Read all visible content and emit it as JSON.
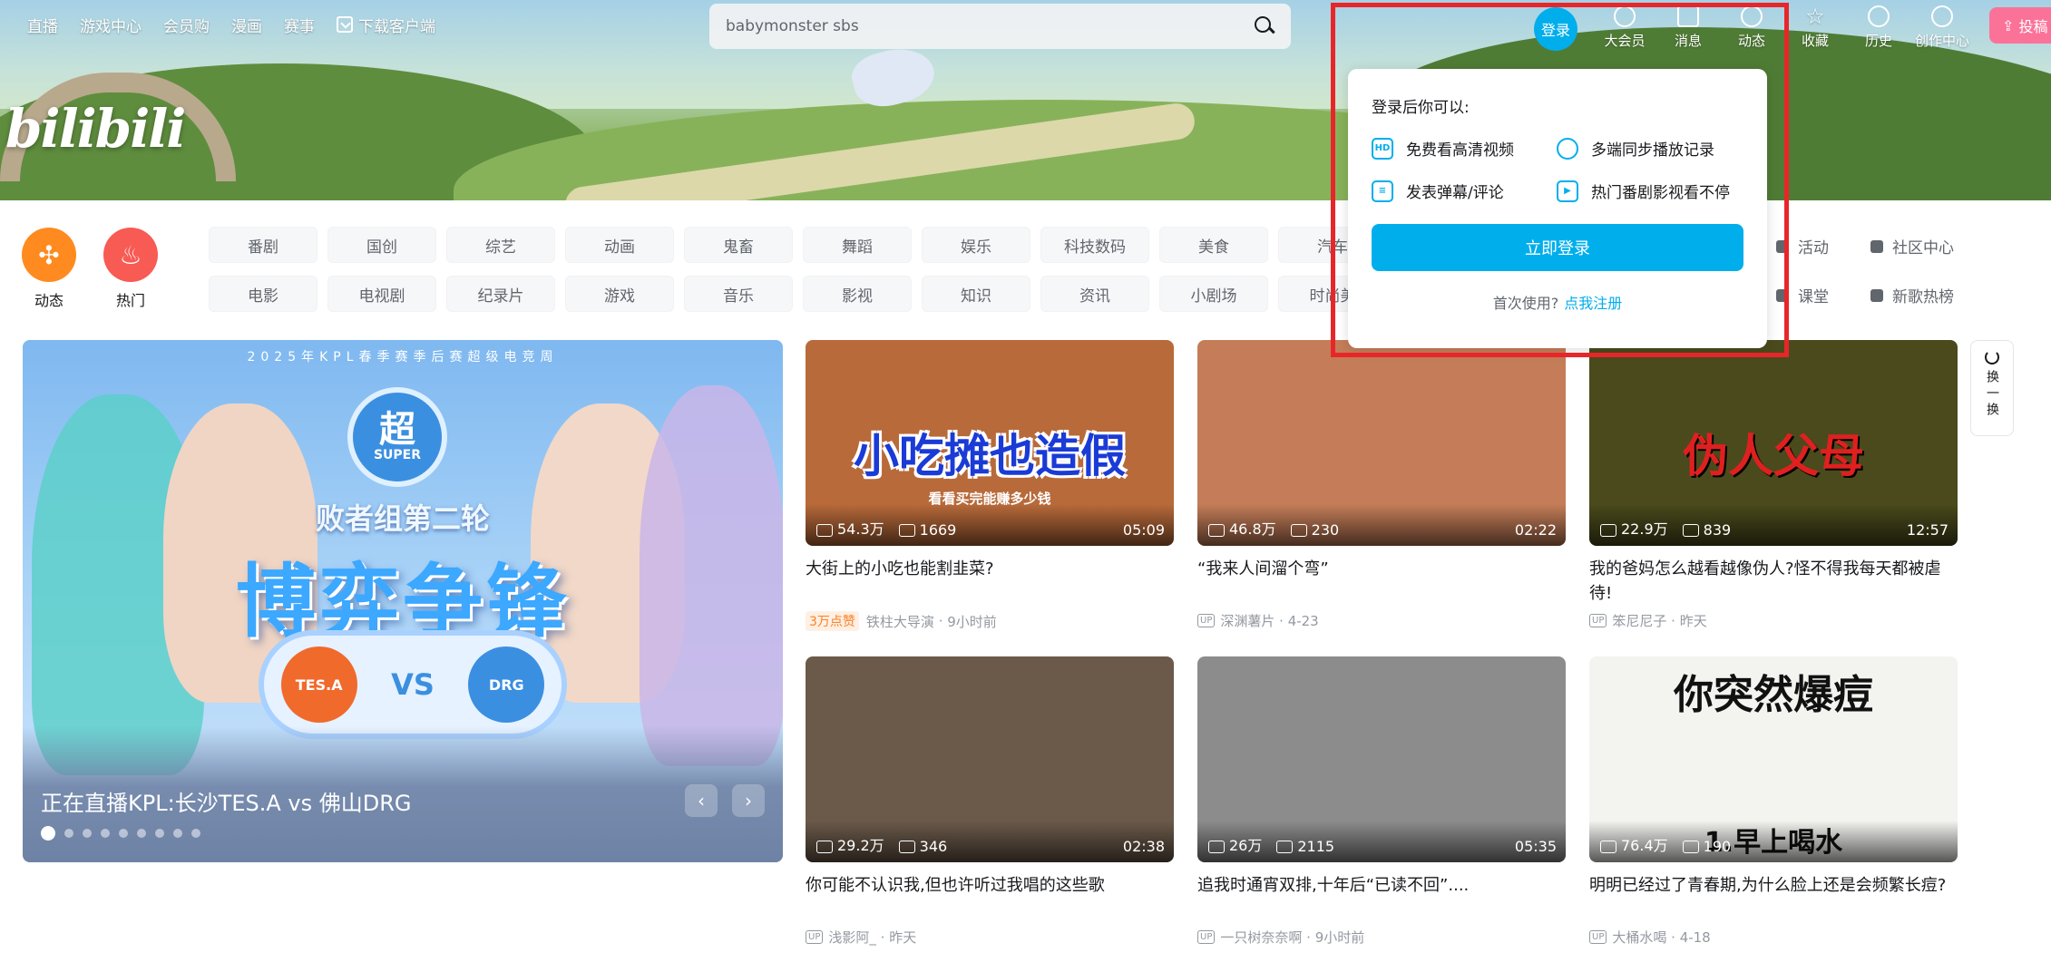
{
  "topnav": {
    "items": [
      "直播",
      "游戏中心",
      "会员购",
      "漫画",
      "赛事"
    ],
    "download": "下载客户端"
  },
  "search": {
    "value": "babymonster sbs"
  },
  "header": {
    "login": "登录",
    "entries": [
      "大会员",
      "消息",
      "动态",
      "收藏",
      "历史",
      "创作中心"
    ],
    "upload": "投稿"
  },
  "logo": "bilibili",
  "round_channels": [
    {
      "label": "动态",
      "color": "#ff8a1f"
    },
    {
      "label": "热门",
      "color": "#f85a54"
    }
  ],
  "channels_row1": [
    "番剧",
    "国创",
    "综艺",
    "动画",
    "鬼畜",
    "舞蹈",
    "娱乐",
    "科技数码",
    "美食",
    "汽车"
  ],
  "channels_row2": [
    "电影",
    "电视剧",
    "纪录片",
    "游戏",
    "音乐",
    "影视",
    "知识",
    "资讯",
    "小剧场",
    "时尚美"
  ],
  "side_links_row1": [
    "活动",
    "社区中心"
  ],
  "side_links_row2": [
    "课堂",
    "新歌热榜"
  ],
  "popover": {
    "title": "登录后你可以:",
    "benefits": [
      {
        "icon": "hd-icon",
        "label": "免费看高清视频"
      },
      {
        "icon": "clock-icon",
        "label": "多端同步播放记录"
      },
      {
        "icon": "danmaku-icon",
        "label": "发表弹幕/评论"
      },
      {
        "icon": "play-icon",
        "label": "热门番剧影视看不停"
      }
    ],
    "login_button": "立即登录",
    "register_prompt": "首次使用?",
    "register_link": "点我注册"
  },
  "carousel": {
    "banner_line": "2025年KPL春季赛季后赛超级电竞周",
    "badge_main": "超",
    "badge_sub": "SUPER",
    "round": "败者组第二轮",
    "headline": "博弈争锋",
    "team_left": "TES.A",
    "team_right": "DRG",
    "vs": "VS",
    "caption": "正在直播KPL:长沙TES.A vs 佛山DRG",
    "dots": 9,
    "active_dot": 0
  },
  "videos": [
    {
      "title": "大街上的小吃也能割韭菜?",
      "views": "54.3万",
      "danmaku": "1669",
      "duration": "05:09",
      "badge": "3万点赞",
      "author": "铁柱大导演",
      "date": "9小时前",
      "overlay": "小吃摊也造假",
      "overlay_sub": "看看买完能赚多少钱",
      "bg": "#b86a3a"
    },
    {
      "title": "“我来人间溜个弯”",
      "views": "46.8万",
      "danmaku": "230",
      "duration": "02:22",
      "badge": "",
      "author": "深渊薯片",
      "date": "4-23",
      "overlay": "",
      "overlay_sub": "",
      "bg": "#c47d58"
    },
    {
      "title": "我的爸妈怎么越看越像伪人?怪不得我每天都被虐待!",
      "views": "22.9万",
      "danmaku": "839",
      "duration": "12:57",
      "badge": "",
      "author": "笨尼尼子",
      "date": "昨天",
      "overlay": "伪人父母",
      "overlay_sub": "",
      "bg": "#4a4a1c"
    },
    {
      "title": "你可能不认识我,但也许听过我唱的这些歌",
      "views": "29.2万",
      "danmaku": "346",
      "duration": "02:38",
      "badge": "",
      "author": "浅影阿_",
      "date": "昨天",
      "overlay": "",
      "overlay_sub": "",
      "bg": "#6b5a4a"
    },
    {
      "title": "追我时通宵双排,十年后“已读不回”....",
      "views": "26万",
      "danmaku": "2115",
      "duration": "05:35",
      "badge": "",
      "author": "一只树奈奈啊",
      "date": "9小时前",
      "overlay": "",
      "overlay_sub": "",
      "bg": "#8c8c8c"
    },
    {
      "title": "明明已经过了青春期,为什么脸上还是会频繁长痘?",
      "views": "76.4万",
      "danmaku": "190",
      "duration": "",
      "badge": "",
      "author": "大桶水喝",
      "date": "4-18",
      "overlay": "你突然爆痘",
      "overlay_sub": "1.早上喝水",
      "bg": "#f3f3f0"
    }
  ],
  "refresh": "换一换"
}
